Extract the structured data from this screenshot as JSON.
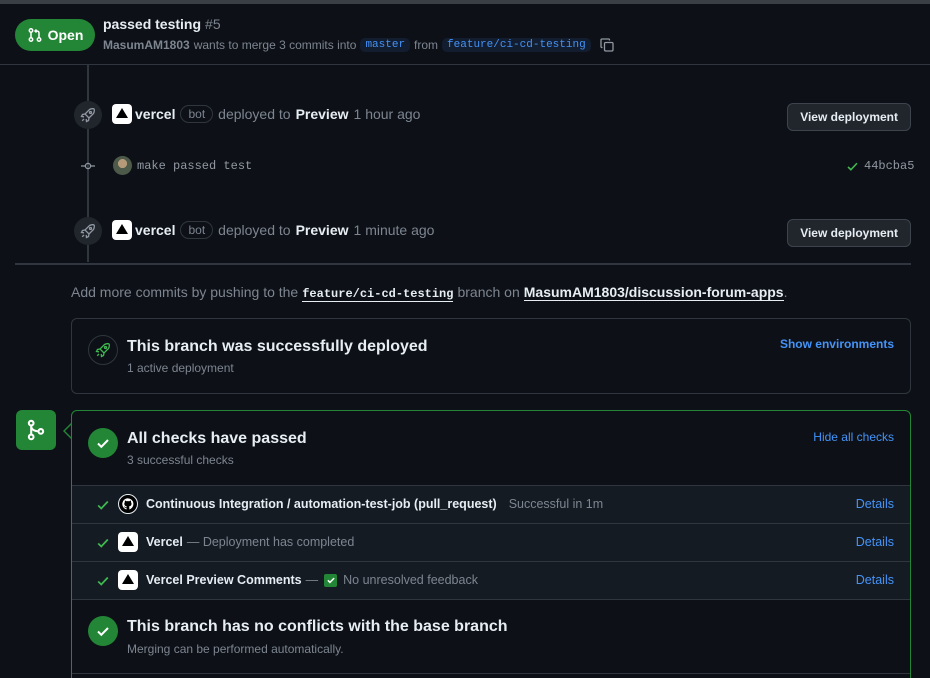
{
  "header": {
    "state": "Open",
    "title": "passed testing",
    "number": "#5",
    "author": "MasumAM1803",
    "merge_text": "wants to merge 3 commits into",
    "base_branch": "master",
    "from_text": "from",
    "head_branch": "feature/ci-cd-testing"
  },
  "timeline": {
    "events": [
      {
        "actor": "vercel",
        "badge": "bot",
        "action": "deployed to",
        "env": "Preview",
        "time": "1 hour ago",
        "button": "View deployment"
      },
      {
        "actor": "vercel",
        "badge": "bot",
        "action": "deployed to",
        "env": "Preview",
        "time": "1 minute ago",
        "button": "View deployment"
      }
    ],
    "commit": {
      "message": "make passed test",
      "sha": "44bcba5"
    }
  },
  "push_hint": {
    "prefix": "Add more commits by pushing to the",
    "branch": "feature/ci-cd-testing",
    "middle": "branch on",
    "repo": "MasumAM1803/discussion-forum-apps",
    "suffix": "."
  },
  "deployment": {
    "title": "This branch was successfully deployed",
    "subtitle": "1 active deployment",
    "link": "Show environments"
  },
  "checks": {
    "title": "All checks have passed",
    "subtitle": "3 successful checks",
    "toggle": "Hide all checks",
    "items": [
      {
        "name": "Continuous Integration / automation-test-job (pull_request)",
        "status": "Successful in 1m",
        "details": "Details"
      },
      {
        "name": "Vercel",
        "status": "— Deployment has completed",
        "details": "Details"
      },
      {
        "name": "Vercel Preview Comments",
        "status_prefix": "—",
        "status": "No unresolved feedback",
        "details": "Details"
      }
    ]
  },
  "conflicts": {
    "title": "This branch has no conflicts with the base branch",
    "subtitle": "Merging can be performed automatically."
  },
  "colors": {
    "success": "#238636",
    "link": "#4493f8",
    "background": "#0d1117"
  }
}
